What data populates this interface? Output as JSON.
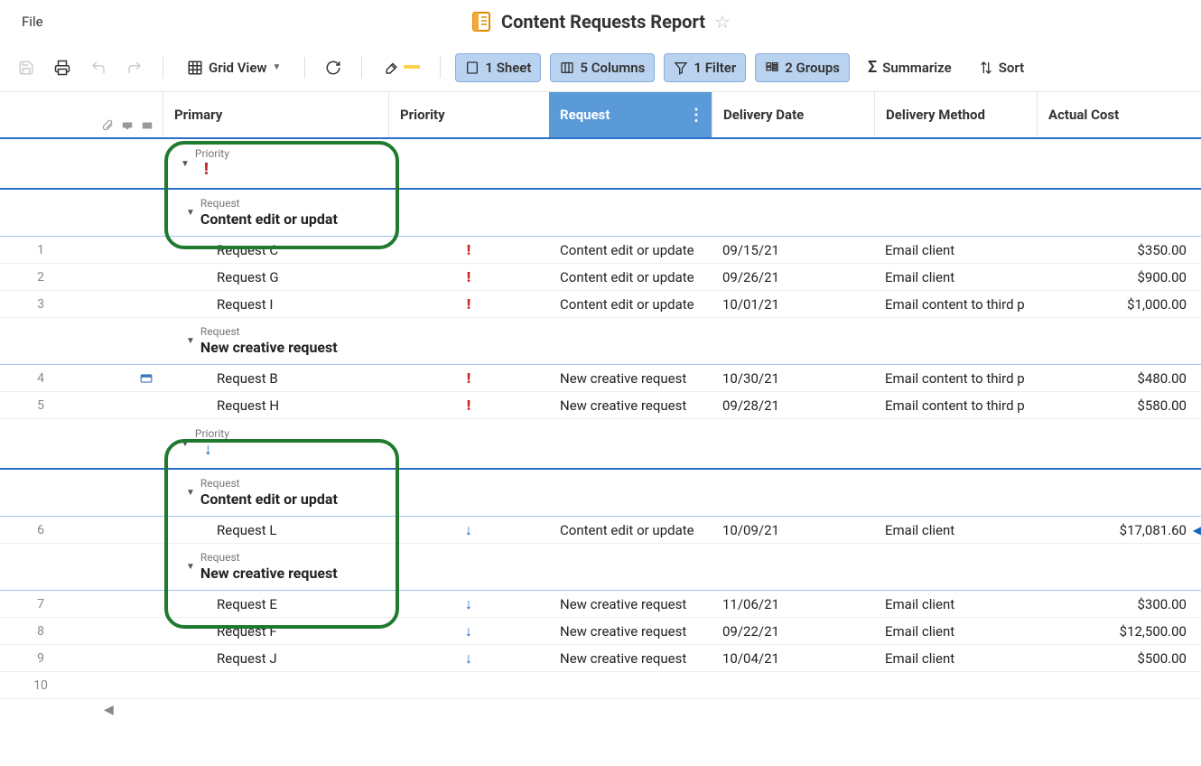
{
  "menu": {
    "file": "File"
  },
  "title": "Content Requests Report",
  "toolbar": {
    "view_label": "Grid View",
    "sheet_label": "1 Sheet",
    "columns_label": "5 Columns",
    "filter_label": "1 Filter",
    "groups_label": "2 Groups",
    "summarize_label": "Summarize",
    "sort_label": "Sort"
  },
  "columns": {
    "primary": "Primary",
    "priority": "Priority",
    "request": "Request",
    "delivery_date": "Delivery Date",
    "delivery_method": "Delivery Method",
    "actual_cost": "Actual Cost"
  },
  "group_labels": {
    "priority": "Priority",
    "request": "Request"
  },
  "group_values": {
    "content_edit": "Content edit or updat",
    "new_creative": "New creative request"
  },
  "rows": {
    "1": {
      "primary": "Request C",
      "pri": "high",
      "request": "Content edit or update",
      "date": "09/15/21",
      "method": "Email client",
      "cost": "$350.00",
      "icon": ""
    },
    "2": {
      "primary": "Request G",
      "pri": "high",
      "request": "Content edit or update",
      "date": "09/26/21",
      "method": "Email client",
      "cost": "$900.00",
      "icon": ""
    },
    "3": {
      "primary": "Request I",
      "pri": "high",
      "request": "Content edit or update",
      "date": "10/01/21",
      "method": "Email content to third p",
      "cost": "$1,000.00",
      "icon": ""
    },
    "4": {
      "primary": "Request B",
      "pri": "high",
      "request": "New creative request",
      "date": "10/30/21",
      "method": "Email content to third p",
      "cost": "$480.00",
      "icon": "card"
    },
    "5": {
      "primary": "Request H",
      "pri": "high",
      "request": "New creative request",
      "date": "09/28/21",
      "method": "Email content to third p",
      "cost": "$580.00",
      "icon": ""
    },
    "6": {
      "primary": "Request L",
      "pri": "low",
      "request": "Content edit or update",
      "date": "10/09/21",
      "method": "Email client",
      "cost": "$17,081.60",
      "icon": ""
    },
    "7": {
      "primary": "Request E",
      "pri": "low",
      "request": "New creative request",
      "date": "11/06/21",
      "method": "Email client",
      "cost": "$300.00",
      "icon": ""
    },
    "8": {
      "primary": "Request F",
      "pri": "low",
      "request": "New creative request",
      "date": "09/22/21",
      "method": "Email client",
      "cost": "$12,500.00",
      "icon": ""
    },
    "9": {
      "primary": "Request J",
      "pri": "low",
      "request": "New creative request",
      "date": "10/04/21",
      "method": "Email client",
      "cost": "$500.00",
      "icon": ""
    },
    "10": {
      "primary": "",
      "pri": "",
      "request": "",
      "date": "",
      "method": "",
      "cost": "",
      "icon": ""
    }
  }
}
